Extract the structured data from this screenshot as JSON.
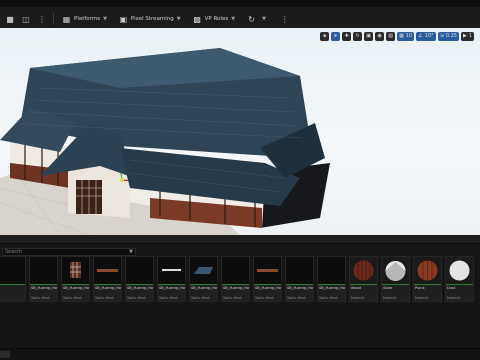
{
  "toolbar": {
    "buttons": [
      {
        "label": "Platforms",
        "icon": "grid-icon"
      },
      {
        "label": "Pixel Streaming",
        "icon": "stream-icon"
      },
      {
        "label": "VP Roles",
        "icon": "vp-icon"
      }
    ]
  },
  "viewport": {
    "controls": [
      {
        "icon": "perspective-icon",
        "value": "",
        "active": false
      },
      {
        "icon": "select-icon",
        "value": "",
        "active": true
      },
      {
        "icon": "move-icon",
        "value": "",
        "active": false
      },
      {
        "icon": "rotate-icon",
        "value": "",
        "active": false
      },
      {
        "icon": "scale-icon",
        "value": "",
        "active": false
      },
      {
        "icon": "world-icon",
        "value": "",
        "active": false
      },
      {
        "icon": "surface-snap-icon",
        "value": "",
        "active": false
      },
      {
        "icon": "grid-snap-icon",
        "value": "10",
        "active": true
      },
      {
        "icon": "angle-snap-icon",
        "value": "10°",
        "active": true
      },
      {
        "icon": "scale-snap-icon",
        "value": "0.25",
        "active": true
      },
      {
        "icon": "camera-speed-icon",
        "value": "1",
        "active": false
      }
    ]
  },
  "content_browser": {
    "search_placeholder": "Search",
    "assets": [
      {
        "name": "",
        "type": "",
        "thumb": "dark"
      },
      {
        "name": "SB_Yuzeng_House_Door_Main",
        "type": "Static Mesh",
        "thumb": "dark"
      },
      {
        "name": "SB_Yuzeng_House_Door_Window",
        "type": "Static Mesh",
        "thumb": "window"
      },
      {
        "name": "SB_Yuzeng_House_Beam",
        "type": "Static Mesh",
        "thumb": "beam"
      },
      {
        "name": "SB_Yuzeng_House_LockR",
        "type": "Static Mesh",
        "thumb": "dark"
      },
      {
        "name": "SB_Yuzeng_House_Plank",
        "type": "Static Mesh",
        "thumb": "plank"
      },
      {
        "name": "SB_Yuzeng_House_Roof",
        "type": "Static Mesh",
        "thumb": "roof"
      },
      {
        "name": "SB_Yuzeng_House_Shutter",
        "type": "Static Mesh",
        "thumb": "dark"
      },
      {
        "name": "SB_Yuzeng_House_Small",
        "type": "Static Mesh",
        "thumb": "beam"
      },
      {
        "name": "SB_Yuzeng_House_Wall",
        "type": "Static Mesh",
        "thumb": "dark"
      },
      {
        "name": "SB_Yuzeng_House_wall",
        "type": "Static Mesh",
        "thumb": "dark"
      },
      {
        "name": "Wood",
        "type": "Material",
        "thumb": "wood"
      },
      {
        "name": "Slate",
        "type": "Material",
        "thumb": "slate"
      },
      {
        "name": "Plank",
        "type": "Material",
        "thumb": "plank-ball"
      },
      {
        "name": "Dust",
        "type": "Material",
        "thumb": "white"
      }
    ]
  },
  "colors": {
    "accent": "#2b5c9c",
    "asset_bar": "#2a7d2a"
  }
}
